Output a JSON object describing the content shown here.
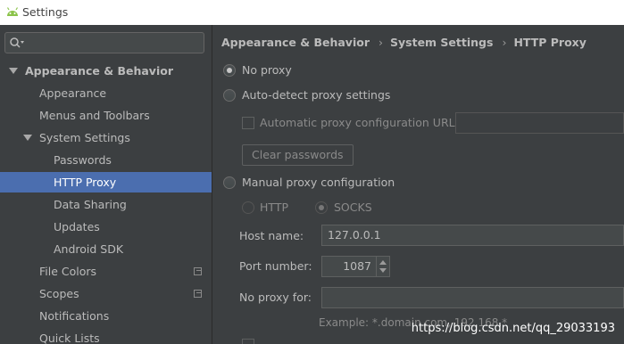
{
  "window": {
    "title": "Settings"
  },
  "search": {
    "placeholder": ""
  },
  "sidebar": {
    "items": [
      {
        "label": "Appearance & Behavior"
      },
      {
        "label": "Appearance"
      },
      {
        "label": "Menus and Toolbars"
      },
      {
        "label": "System Settings"
      },
      {
        "label": "Passwords"
      },
      {
        "label": "HTTP Proxy"
      },
      {
        "label": "Data Sharing"
      },
      {
        "label": "Updates"
      },
      {
        "label": "Android SDK"
      },
      {
        "label": "File Colors"
      },
      {
        "label": "Scopes"
      },
      {
        "label": "Notifications"
      },
      {
        "label": "Quick Lists"
      }
    ]
  },
  "breadcrumb": [
    "Appearance & Behavior",
    "System Settings",
    "HTTP Proxy"
  ],
  "proxy": {
    "no_proxy": "No proxy",
    "auto_detect": "Auto-detect proxy settings",
    "auto_config_url": "Automatic proxy configuration URL:",
    "clear_passwords": "Clear passwords",
    "manual": "Manual proxy configuration",
    "http": "HTTP",
    "socks": "SOCKS",
    "host_label": "Host name:",
    "host_value": "127.0.0.1",
    "port_label": "Port number:",
    "port_value": "1087",
    "no_proxy_for_label": "No proxy for:",
    "example": "Example: *.domain.com, 192.168.*"
  },
  "watermark": "https://blog.csdn.net/qq_29033193",
  "colors": {
    "selection": "#4b6eaf",
    "background": "#3c3f41"
  }
}
